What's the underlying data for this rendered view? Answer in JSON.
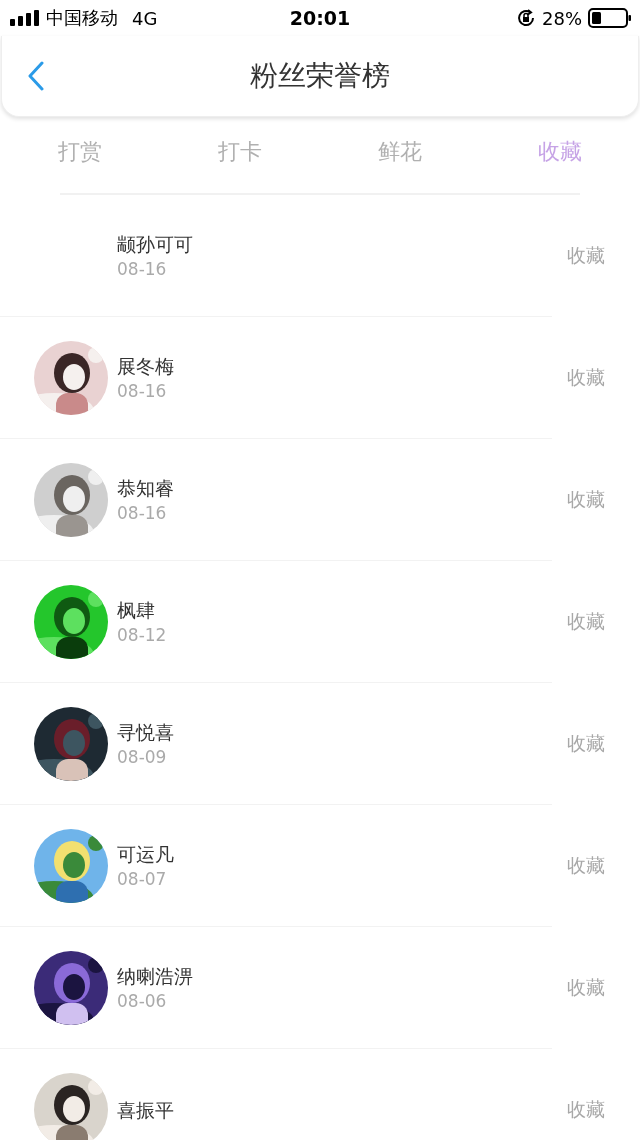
{
  "status_bar": {
    "carrier": "中国移动",
    "network": "4G",
    "time": "20:01",
    "battery": "28%"
  },
  "header": {
    "title": "粉丝荣誉榜"
  },
  "tabs": [
    {
      "label": "打赏",
      "selected": false
    },
    {
      "label": "打卡",
      "selected": false
    },
    {
      "label": "鲜花",
      "selected": false
    },
    {
      "label": "收藏",
      "selected": true
    }
  ],
  "rows": [
    {
      "name": "颛孙可可",
      "date": "08-16",
      "action": "收藏",
      "avatar": false
    },
    {
      "name": "展冬梅",
      "date": "08-16",
      "action": "收藏",
      "avatar": true
    },
    {
      "name": "恭知睿",
      "date": "08-16",
      "action": "收藏",
      "avatar": true
    },
    {
      "name": "枫肆",
      "date": "08-12",
      "action": "收藏",
      "avatar": true
    },
    {
      "name": "寻悦喜",
      "date": "08-09",
      "action": "收藏",
      "avatar": true
    },
    {
      "name": "可运凡",
      "date": "08-07",
      "action": "收藏",
      "avatar": true
    },
    {
      "name": "纳喇浩淠",
      "date": "08-06",
      "action": "收藏",
      "avatar": true
    },
    {
      "name": "喜振平",
      "action": "收藏",
      "avatar": true
    }
  ]
}
